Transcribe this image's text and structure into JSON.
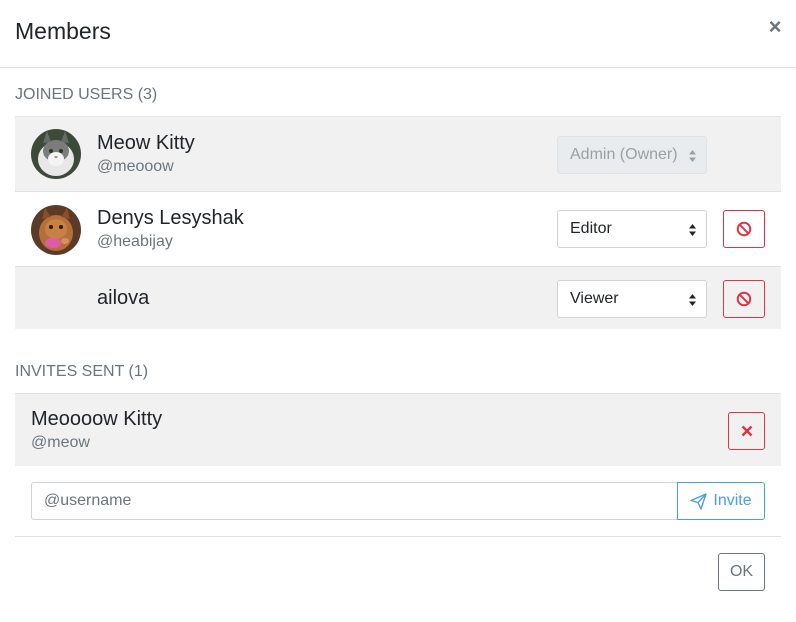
{
  "modal": {
    "title": "Members",
    "close_label": "×"
  },
  "joined": {
    "title": "JOINED USERS (3)",
    "users": [
      {
        "name": "Meow Kitty",
        "handle": "@meooow",
        "role": "Admin (Owner)",
        "role_disabled": true,
        "avatar": "cat-avatar"
      },
      {
        "name": "Denys Lesyshak",
        "handle": "@heabijay",
        "role": "Editor",
        "role_disabled": false,
        "avatar": "cat-avatar"
      },
      {
        "name": "ailova",
        "handle": "",
        "role": "Viewer",
        "role_disabled": false,
        "avatar": ""
      }
    ]
  },
  "invites": {
    "title": "INVITES SENT (1)",
    "items": [
      {
        "name": "Meoooow Kitty",
        "handle": "@meow"
      }
    ]
  },
  "invite_form": {
    "placeholder": "@username",
    "button_label": "Invite",
    "button_icon": "paper-plane-icon"
  },
  "footer": {
    "ok_label": "OK"
  },
  "colors": {
    "danger": "#dc3545",
    "primary": "#4a9fe0",
    "row_bg": "#f1f1f2",
    "muted": "#6c757d"
  }
}
